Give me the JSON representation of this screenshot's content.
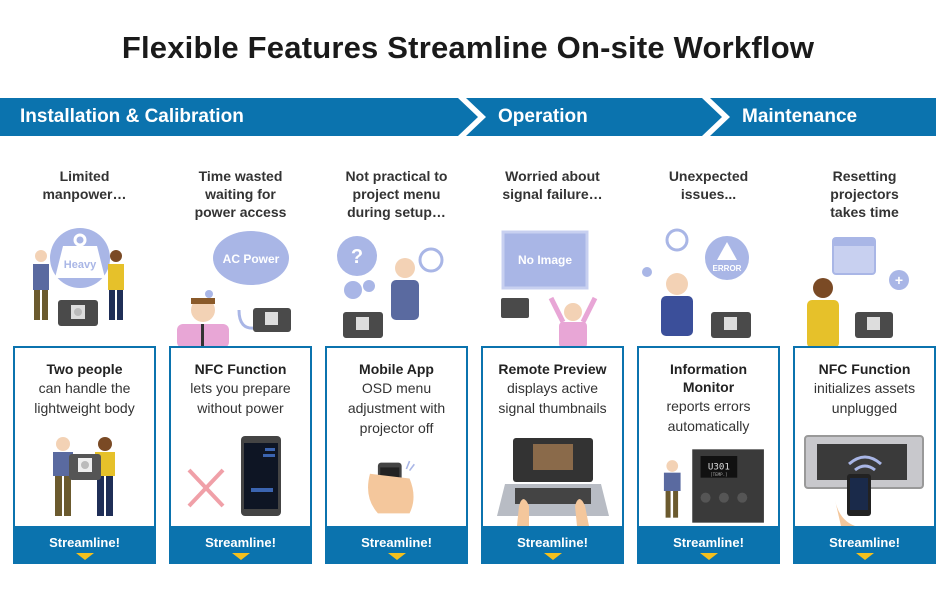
{
  "title": "Flexible Features Streamline On-site Workflow",
  "colors": {
    "accent": "#0b73ae",
    "arrow": "#f4c01e",
    "illustration": "#a9b6e6"
  },
  "phases": [
    {
      "label": "Installation & Calibration"
    },
    {
      "label": "Operation"
    },
    {
      "label": "Maintenance"
    }
  ],
  "columns": [
    {
      "problem": "Limited manpower…",
      "bubble": "Heavy",
      "solution_title": "Two people",
      "solution_desc": "can handle the lightweight body",
      "footer": "Streamline!"
    },
    {
      "problem": "Time wasted waiting for power access",
      "bubble": "AC Power",
      "solution_title": "NFC Function",
      "solution_desc": "lets you prepare without power",
      "footer": "Streamline!"
    },
    {
      "problem": "Not practical to project menu during setup…",
      "bubble": "?",
      "solution_title": "Mobile App",
      "solution_desc": "OSD menu adjustment with projector off",
      "footer": "Streamline!"
    },
    {
      "problem": "Worried about signal failure…",
      "bubble": "No Image",
      "solution_title": "Remote Preview",
      "solution_desc": "displays active signal thumbnails",
      "footer": "Streamline!"
    },
    {
      "problem": "Unexpected issues...",
      "bubble": "ERROR",
      "solution_title": "Information Monitor",
      "solution_desc": "reports errors automatically",
      "display_code": "U301",
      "display_sub": "[TEMP.]",
      "footer": "Streamline!"
    },
    {
      "problem": "Resetting projectors takes time",
      "bubble": "+",
      "solution_title": "NFC Function",
      "solution_desc": "initializes assets unplugged",
      "footer": "Streamline!"
    }
  ]
}
